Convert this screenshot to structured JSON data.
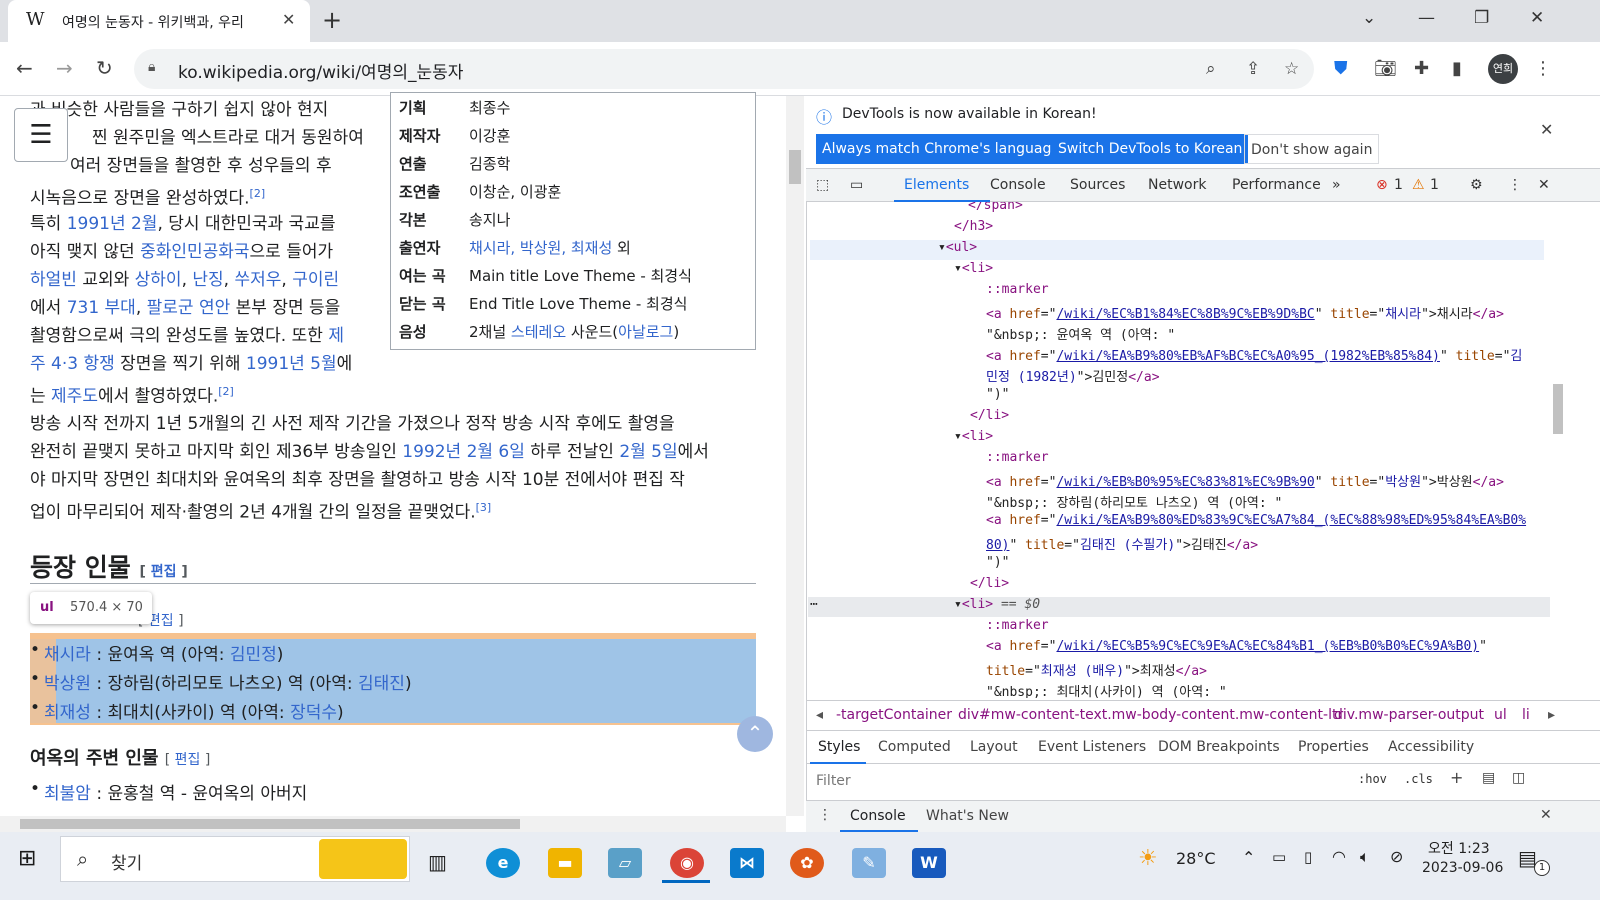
{
  "browser": {
    "tab_title": "여명의 눈동자 - 위키백과, 우리",
    "tab_favicon": "W",
    "url": "ko.wikipedia.org/wiki/여명의_눈동자",
    "profile_label": "연희"
  },
  "article": {
    "para1": "과 비슷한 사람들을 구하기 쉽지 않아 현지 … 찐 원주민을 엑스트라로 대거 동원하여 … 여러 장면들을 촬영한 후 성우들의 후 시녹음으로 장면을 완성하였다.",
    "para1_lines": [
      "과 비슷한 사람들을 구하기 쉽지 않아 현지",
      "찐 원주민을 엑스트라로 대거 동원하여",
      "여러 장면들을 촬영한 후 성우들의 후",
      "시녹음으로 장면을 완성하였다."
    ],
    "ref2": "[2]",
    "ref3": "[3]",
    "para2_lines": [
      [
        "특히 ",
        "1991년 2월",
        ", 당시 대한민국과 국교를"
      ],
      [
        "아직 맺지 않던 ",
        "중화인민공화국",
        "으로 들어가"
      ],
      [
        "하얼빈",
        " 교외와 ",
        "상하이",
        ", ",
        "난징",
        ", ",
        "쑤저우",
        ", ",
        "구이린"
      ],
      [
        "에서 ",
        "731 부대",
        ", ",
        "팔로군 연안",
        " 본부 장면 등을"
      ],
      [
        "촬영함으로써 극의 완성도를 높였다. 또한 ",
        "제"
      ],
      [
        "주 4·3 항쟁",
        " 장면을 찍기 위해 ",
        "1991년 5월",
        "에"
      ],
      [
        "는 ",
        "제주도",
        "에서 촬영하였다."
      ]
    ],
    "para3_lines": [
      "방송 시작 전까지 1년 5개월의 긴 사전 제작 기간을 가졌으나 정작 방송 시작 후에도 촬영을",
      "완전히 끝맺지 못하고 마지막 회인 제36부 방송일인 ",
      "1992년 2월 6일",
      " 하루 전날인 ",
      "2월 5일",
      "에서",
      "야 마지막 장면인 최대치와 윤여옥의 최후 장면을 촬영하고 방송 시작 10분 전에서야 편집 작",
      "업이 마무리되어 제작·촬영의 2년 4개월 간의 일정을 끝맺었다."
    ],
    "section_heading": "등장 인물",
    "edit_label": "[ 편집 ]",
    "subsection_partial": "편집",
    "main_cast": [
      {
        "actor": "채시라",
        "role": " : 윤여옥 역 (아역: ",
        "child": "김민정",
        "end": ")"
      },
      {
        "actor": "박상원",
        "role": " : 장하림(하리모토 나츠오) 역 (아역: ",
        "child": "김태진",
        "end": ")"
      },
      {
        "actor": "최재성",
        "role": " : 최대치(사카이) 역 (아역: ",
        "child": "장덕수",
        "end": ")"
      }
    ],
    "subheading2": "여옥의 주변 인물",
    "others": [
      {
        "actor": "최불암",
        "role": " : 윤홍철 역 - 윤여옥의 아버지"
      }
    ],
    "tooltip_tag": "ul",
    "tooltip_dim": "570.4 × 70"
  },
  "infobox": [
    {
      "k": "기획",
      "v": "최종수"
    },
    {
      "k": "제작자",
      "v": "이강훈"
    },
    {
      "k": "연출",
      "v": "김종학",
      "link": true
    },
    {
      "k": "조연출",
      "v": "이창순, 이광훈",
      "link": true
    },
    {
      "k": "각본",
      "v": "송지나",
      "link": true
    },
    {
      "k": "출연자",
      "v": "채시라, 박상원, 최재성",
      "extra": " 외"
    },
    {
      "k": "여는 곡",
      "v": "Main title Love Theme - 최경식"
    },
    {
      "k": "닫는 곡",
      "v": "End Title Love Theme - 최경식"
    },
    {
      "k": "음성",
      "v": "2채널 ",
      "v2": "스테레오",
      "v3": " 사운드(",
      "v4": "아날로그",
      "v5": ")"
    }
  ],
  "devtools": {
    "banner_text": "DevTools is now available in Korean!",
    "btn_match": "Always match Chrome's language",
    "btn_switch": "Switch DevTools to Korean",
    "btn_dont": "Don't show again",
    "tabs": [
      "Elements",
      "Console",
      "Sources",
      "Network",
      "Performance"
    ],
    "more_tabs": "»",
    "errors": "1",
    "warnings": "1",
    "tree": {
      "l1": "</span>",
      "l2": "</h3>",
      "l3": "<ul>",
      "li_open": "<li>",
      "li_close": "</li>",
      "marker": "::marker",
      "a1_href": "/wiki/%EC%B1%84%EC%8B%9C%EB%9D%BC",
      "a1_title": "채시라",
      "a1_text": "채시라",
      "nbsp1": "\"&nbsp;: 윤여옥 역 (아역: \"",
      "a2_href": "/wiki/%EA%B9%80%EB%AF%BC%EC%A0%95_(1982%EB%85%84)",
      "a2_title_1": "김",
      "a2_title_2": "민정 (1982년)",
      "a2_text": "김민정",
      "close_paren": "\")\"",
      "a3_href": "/wiki/%EB%B0%95%EC%83%81%EC%9B%90",
      "a3_title": "박상원",
      "a3_text": "박상원",
      "nbsp2": "\"&nbsp;: 장하림(하리모토 나츠오) 역 (아역: \"",
      "a4_href_1": "/wiki/%EA%B9%80%ED%83%9C%EC%A7%84_(%EC%88%98%ED%95%84%EA%B0%",
      "a4_href_2": "80)",
      "a4_title": "김태진 (수필가)",
      "a4_text": "김태진",
      "sel_suffix": "== $0",
      "a5_href": "/wiki/%EC%B5%9C%EC%9E%AC%EC%84%B1_(%EB%B0%B0%EC%9A%B0)",
      "a5_title": "최재성 (배우)",
      "a5_text": "최재성",
      "nbsp3": "\"&nbsp;: 최대치(사카이) 역 (아역: \""
    },
    "breadcrumbs": [
      "-targetContainer",
      "div#mw-content-text.mw-body-content.mw-content-ltr",
      "div.mw-parser-output",
      "ul",
      "li"
    ],
    "style_tabs": [
      "Styles",
      "Computed",
      "Layout",
      "Event Listeners",
      "DOM Breakpoints",
      "Properties",
      "Accessibility"
    ],
    "filter_placeholder": "Filter",
    "hov": ":hov",
    "cls": ".cls",
    "drawer_tabs": [
      "Console",
      "What's New"
    ]
  },
  "taskbar": {
    "search_placeholder": "찾기",
    "weather": "28°C",
    "time": "오전 1:23",
    "date": "2023-09-06",
    "notif_count": "1"
  },
  "colors": {
    "link": "#3366cc",
    "accent": "#1a73e8",
    "highlight": "#9fc4e7",
    "margin_highlight": "#f6c28f"
  }
}
